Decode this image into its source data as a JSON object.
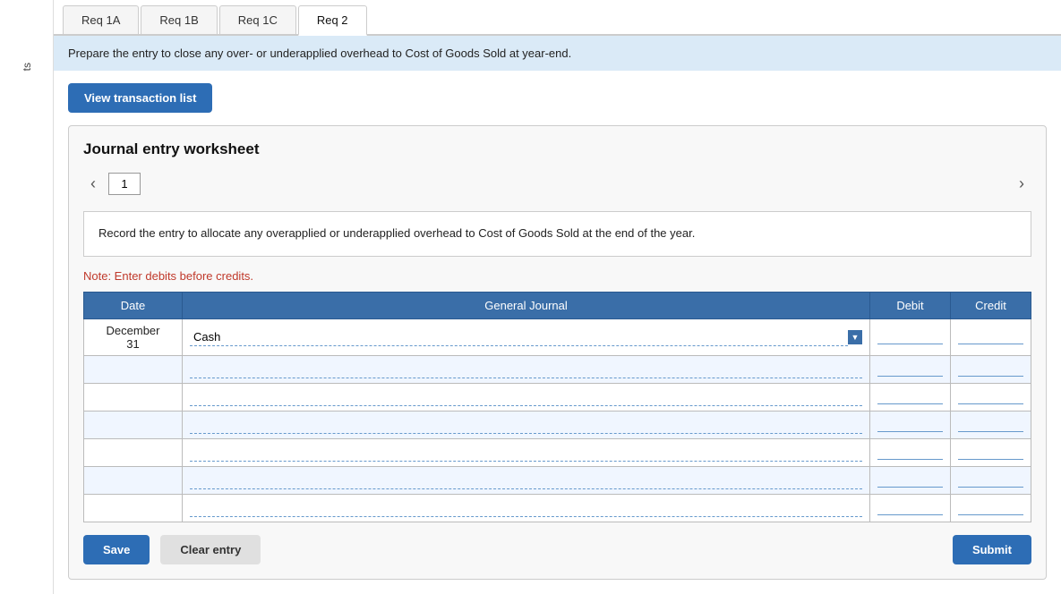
{
  "sidebar": {
    "label": "ts"
  },
  "tabs": [
    {
      "id": "req1a",
      "label": "Req 1A",
      "active": false
    },
    {
      "id": "req1b",
      "label": "Req 1B",
      "active": false
    },
    {
      "id": "req1c",
      "label": "Req 1C",
      "active": false
    },
    {
      "id": "req2",
      "label": "Req 2",
      "active": true
    }
  ],
  "instruction": "Prepare the entry to close any over- or underapplied overhead to Cost of Goods Sold at year-end.",
  "view_transaction_button": "View transaction list",
  "worksheet": {
    "title": "Journal entry worksheet",
    "current_page": "1",
    "entry_description": "Record the entry to allocate any overapplied or underapplied overhead to Cost of Goods Sold at the end of the year.",
    "note": "Note: Enter debits before credits.",
    "table": {
      "columns": [
        "Date",
        "General Journal",
        "Debit",
        "Credit"
      ],
      "rows": [
        {
          "date": "December\n31",
          "journal": "Cash",
          "debit": "",
          "credit": ""
        },
        {
          "date": "",
          "journal": "",
          "debit": "",
          "credit": ""
        },
        {
          "date": "",
          "journal": "",
          "debit": "",
          "credit": ""
        },
        {
          "date": "",
          "journal": "",
          "debit": "",
          "credit": ""
        },
        {
          "date": "",
          "journal": "",
          "debit": "",
          "credit": ""
        },
        {
          "date": "",
          "journal": "",
          "debit": "",
          "credit": ""
        },
        {
          "date": "",
          "journal": "",
          "debit": "",
          "credit": ""
        }
      ]
    }
  },
  "bottom_buttons": {
    "save": "Save",
    "clear": "Clear entry",
    "submit": "Submit"
  }
}
